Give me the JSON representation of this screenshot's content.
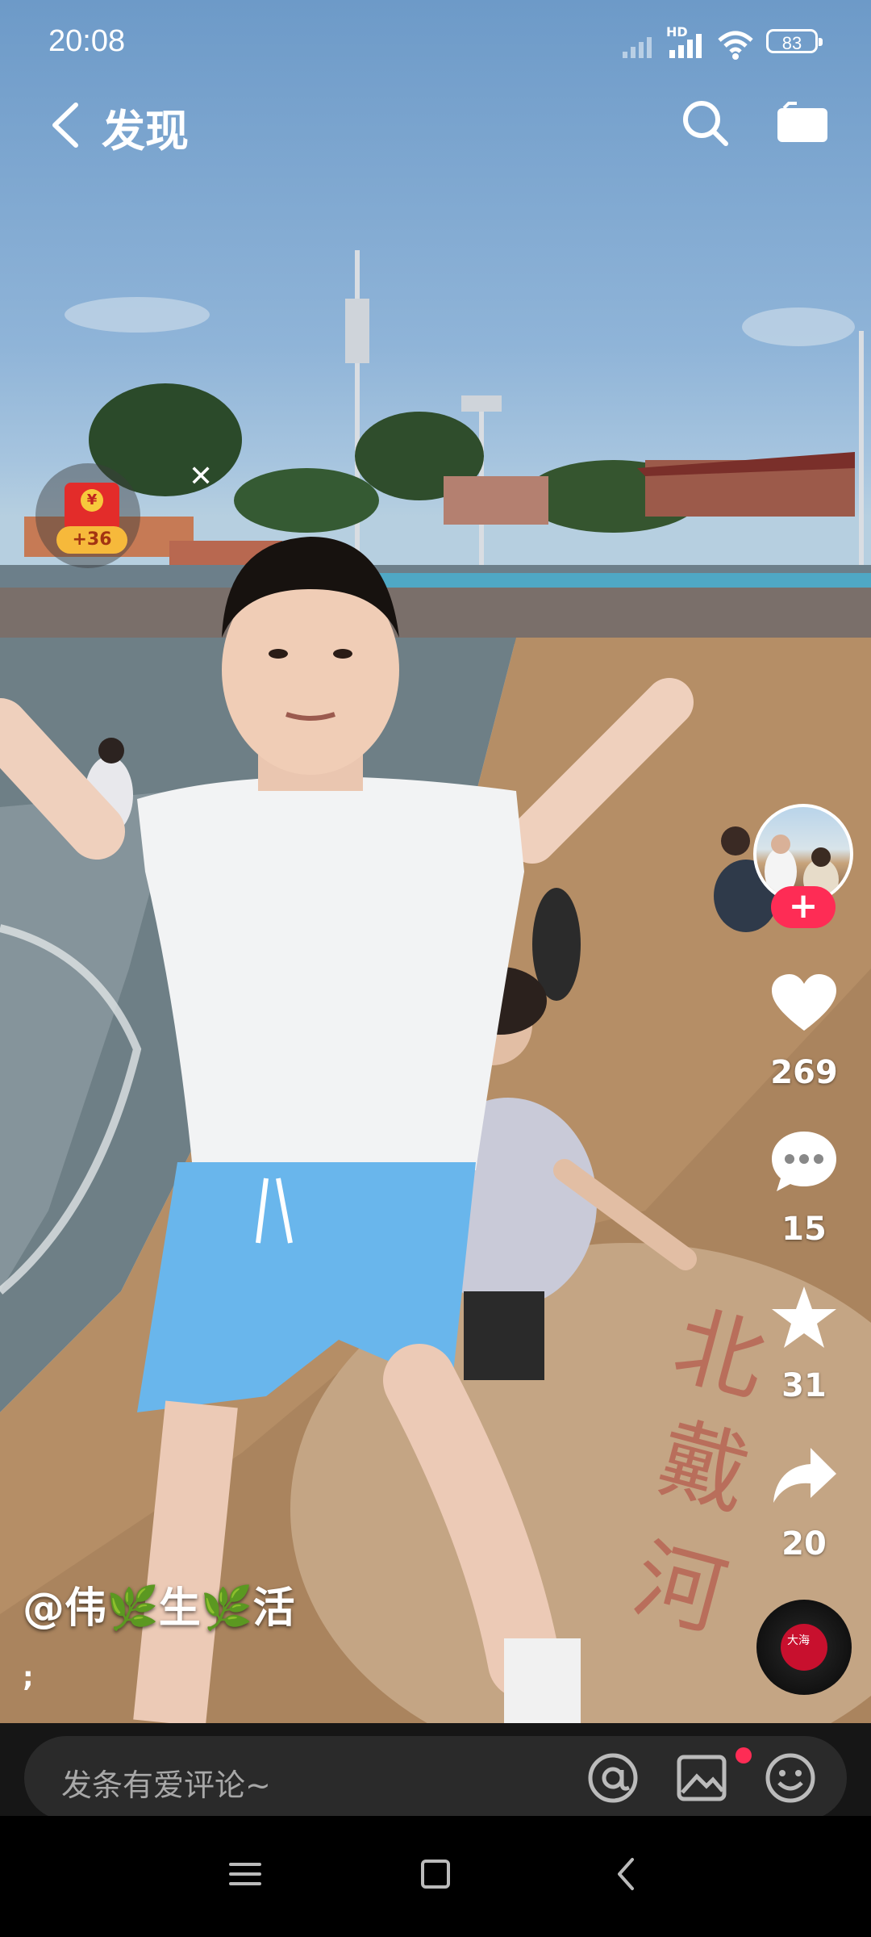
{
  "status_bar": {
    "time": "20:08",
    "network": "HD",
    "battery": "83"
  },
  "header": {
    "title": "发现"
  },
  "red_packet": {
    "badge": "+36",
    "coin": "¥"
  },
  "rail": {
    "follow": "+",
    "likes": "269",
    "comments": "15",
    "favorites": "31",
    "shares": "20",
    "music_disc_text": "大海"
  },
  "video": {
    "author": "@伟🌿生🌿活",
    "author_parts": [
      "@伟",
      "🌿",
      "生",
      "🌿",
      "活"
    ],
    "caption": ";"
  },
  "comment_bar": {
    "placeholder": "发条有爱评论~"
  },
  "colors": {
    "accent": "#fe2c55",
    "packet_red": "#e32c2a",
    "packet_gold": "#f6b93b"
  },
  "icons": [
    "back-arrow-icon",
    "search-icon",
    "camera-icon",
    "heart-icon",
    "comment-icon",
    "star-icon",
    "share-icon",
    "at-icon",
    "image-icon",
    "emoji-icon",
    "menu-icon",
    "home-square-icon",
    "back-triangle-icon"
  ]
}
